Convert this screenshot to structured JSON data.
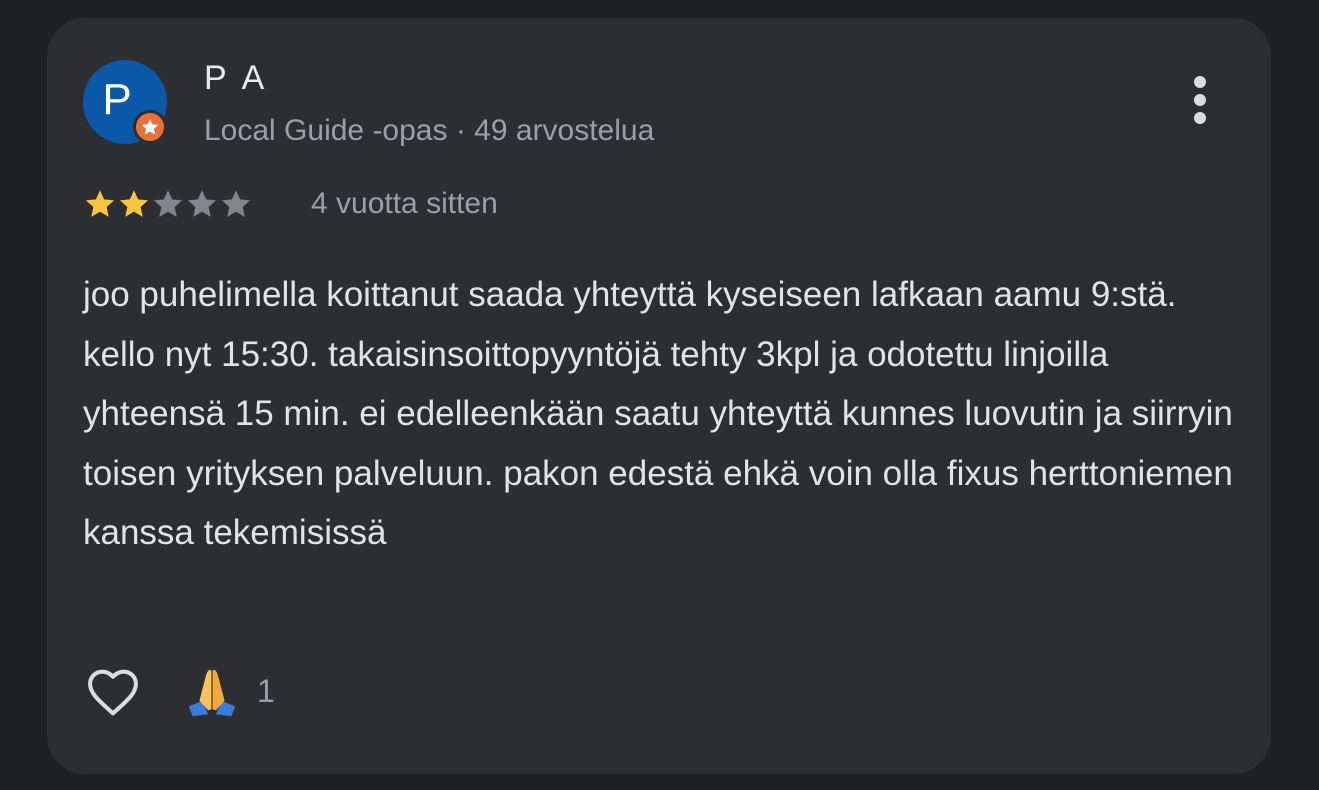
{
  "review": {
    "reviewer": {
      "initial": "P",
      "name": "P A",
      "meta": "Local Guide -opas · 49 arvostelua",
      "avatar_color": "#0b57a8",
      "badge_icon": "local-guide-star-icon",
      "badge_color": "#e8713a"
    },
    "rating": {
      "value": 2,
      "max": 5,
      "filled_color": "#f6c343",
      "empty_color": "#80868b"
    },
    "time": "4 vuotta sitten",
    "text": "joo puhelimella koittanut saada yhteyttä kyseiseen lafkaan aamu 9:stä. kello nyt 15:30. takaisinsoittopyyntöjä tehty 3kpl ja odotettu linjoilla yhteensä 15 min. ei edelleenkään saatu yhteyttä kunnes luovutin ja siirryin toisen yrityksen palveluun. pakon edestä ehkä voin olla fixus herttoniemen kanssa tekemisissä",
    "actions": {
      "more_icon": "more-vertical-icon",
      "like_icon": "heart-outline-icon",
      "reaction_icon": "folded-hands-emoji-icon",
      "reaction_count": "1"
    }
  }
}
